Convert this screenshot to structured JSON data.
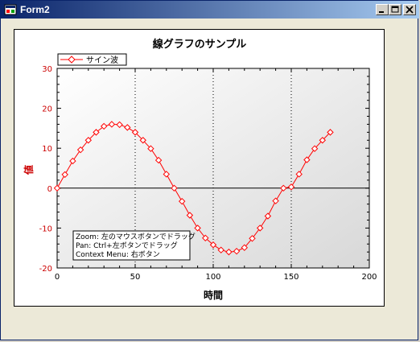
{
  "window": {
    "title": "Form2",
    "minimize_label": "_",
    "maximize_label": "□",
    "close_label": "✕"
  },
  "chart_data": {
    "type": "line",
    "title": "線グラフのサンプル",
    "xlabel": "時間",
    "ylabel": "値",
    "xlim": [
      0,
      200
    ],
    "ylim": [
      -20,
      30
    ],
    "x_ticks": [
      "0",
      "50",
      "100",
      "150",
      "200"
    ],
    "y_ticks": [
      "-20",
      "-10",
      "0",
      "10",
      "20",
      "30"
    ],
    "legend_position": "top-left",
    "grid": "dotted vertical major lines",
    "series": [
      {
        "name": "サイン波",
        "color": "#ff0000",
        "marker": "diamond",
        "x": [
          0,
          5,
          10,
          15,
          20,
          25,
          30,
          35,
          40,
          45,
          50,
          55,
          60,
          65,
          70,
          75,
          80,
          85,
          90,
          95,
          100,
          105,
          110,
          115,
          120,
          125,
          130,
          135,
          140,
          145,
          150,
          155,
          160,
          165,
          170,
          175
        ],
        "values": [
          0,
          3.4,
          6.8,
          9.6,
          12,
          14,
          15.5,
          16,
          15.9,
          15.2,
          14,
          12,
          9.9,
          7,
          3.5,
          0,
          -3.3,
          -6.8,
          -10,
          -12.5,
          -14.2,
          -15.5,
          -16,
          -15.8,
          -14.9,
          -12.6,
          -10,
          -7,
          -3.2,
          0,
          0.3,
          3.5,
          7.1,
          9.9,
          12,
          14
        ]
      }
    ]
  },
  "annotation": {
    "lines": [
      "Zoom: 左のマウスボタンでドラッグ",
      "Pan: Ctrl+左ボタンでドラッグ",
      "Context Menu: 右ボタン"
    ]
  }
}
